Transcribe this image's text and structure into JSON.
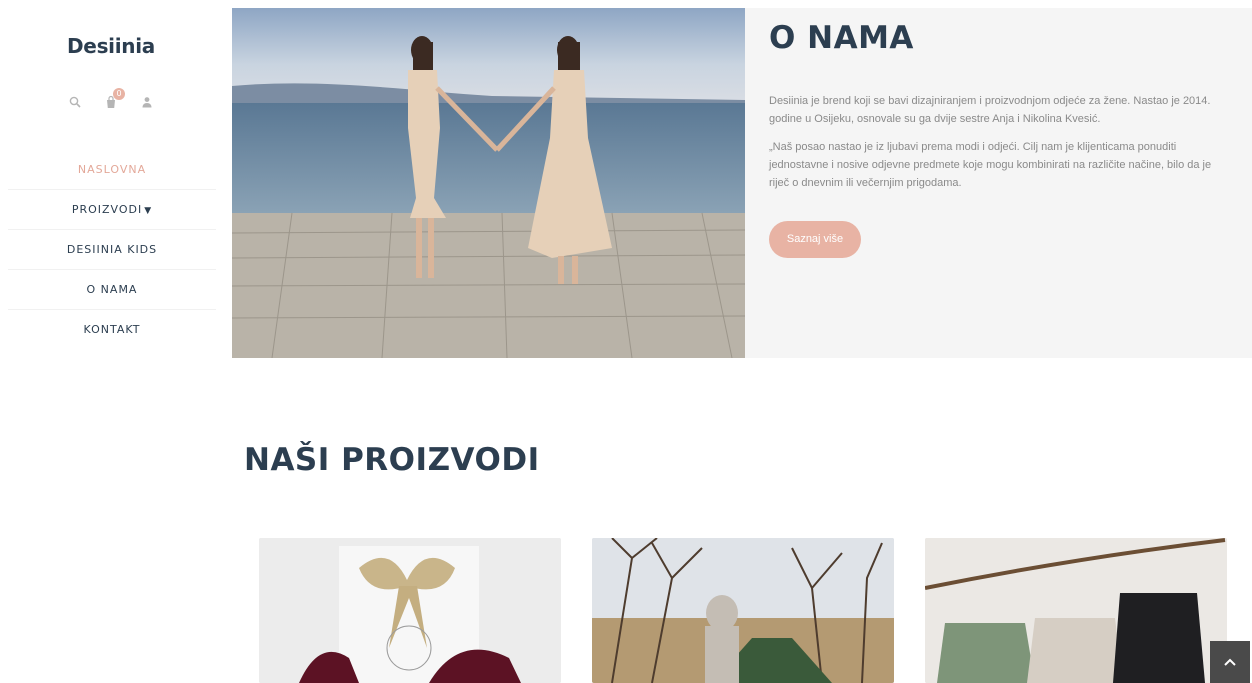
{
  "brand": {
    "logo": "Desiinia"
  },
  "header": {
    "cart_count": "0"
  },
  "nav": {
    "items": [
      {
        "label": "NASLOVNA"
      },
      {
        "label": "PROIZVODI"
      },
      {
        "label": "DESIINIA KIDS"
      },
      {
        "label": "O NAMA"
      },
      {
        "label": "KONTAKT"
      }
    ]
  },
  "about": {
    "title": "O NAMA",
    "p1": "Desiinia je brend koji se bavi dizajniranjem i proizvodnjom odjeće za žene. Nastao je 2014. godine u Osijeku, osnovale su ga dvije sestre Anja i Nikolina Kvesić.",
    "p2": "„Naš posao nastao je iz ljubavi prema modi i odjeći. Cilj nam je klijenticama ponuditi jednostavne i nosive odjevne predmete koje mogu kombinirati na različite načine, bilo da je riječ o dnevnim ili večernjim prigodama.",
    "button": "Saznaj više"
  },
  "products": {
    "title": "NAŠI PROIZVODI"
  },
  "colors": {
    "accent": "#e8b3a4",
    "heading": "#2c3e50",
    "panel": "#f5f5f5"
  },
  "icons": [
    "search-icon",
    "cart-icon",
    "user-icon",
    "chevron-down-icon",
    "arrow-up-icon"
  ]
}
